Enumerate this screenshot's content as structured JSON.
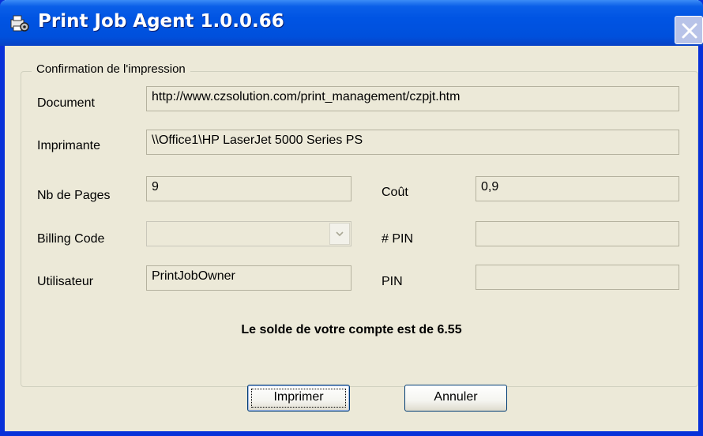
{
  "window": {
    "title": "Print Job Agent 1.0.0.66",
    "icon": "printer-gear-icon",
    "close_icon": "close-icon"
  },
  "group": {
    "legend": "Confirmation de l'impression"
  },
  "fields": {
    "document": {
      "label": "Document",
      "value": "http://www.czsolution.com/print_management/czpjt.htm"
    },
    "printer": {
      "label": "Imprimante",
      "value": "\\\\Office1\\HP LaserJet 5000 Series PS"
    },
    "pages": {
      "label": "Nb de Pages",
      "value": "9"
    },
    "cost": {
      "label": "Coût",
      "value": "0,9"
    },
    "billing_code": {
      "label": "Billing Code",
      "value": ""
    },
    "pin_number": {
      "label": "# PIN",
      "value": ""
    },
    "user": {
      "label": "Utilisateur",
      "value": "PrintJobOwner"
    },
    "pin": {
      "label": "PIN",
      "value": ""
    }
  },
  "balance_text": "Le solde de votre compte est de 6.55",
  "buttons": {
    "print": "Imprimer",
    "cancel": "Annuler"
  },
  "colors": {
    "titlebar": "#0054e3",
    "window_bg": "#ece9d8"
  }
}
